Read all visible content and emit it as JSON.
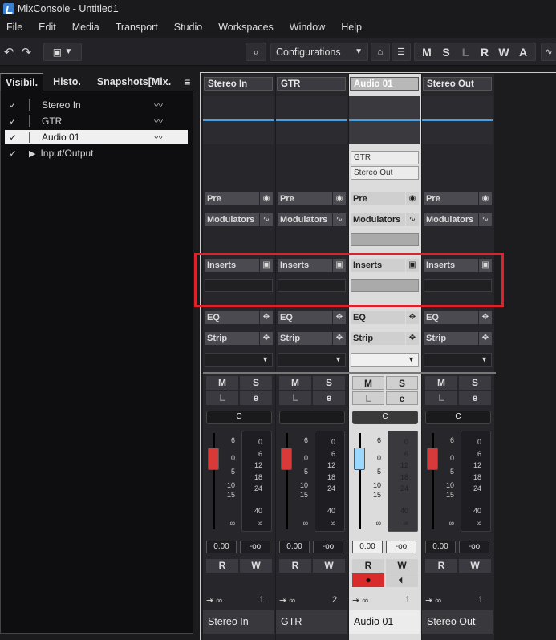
{
  "window": {
    "title": "MixConsole - Untitled1"
  },
  "menu": [
    "File",
    "Edit",
    "Media",
    "Transport",
    "Studio",
    "Workspaces",
    "Window",
    "Help"
  ],
  "toolbar": {
    "configurations_label": "Configurations",
    "msl": [
      "M",
      "S",
      "L",
      "R",
      "W",
      "A"
    ]
  },
  "left_panel": {
    "tabs": [
      "Visibil.",
      "Histo.",
      "Snapshots[Mix."
    ],
    "menu_icon": "≡",
    "items": [
      {
        "check": "✓",
        "label": "Stereo In",
        "wave": "▸▾▸▾"
      },
      {
        "check": "✓",
        "label": "GTR",
        "wave": "▸▾▸▾"
      },
      {
        "check": "✓",
        "label": "Audio 01",
        "wave": "▸▾▸▾"
      },
      {
        "check": "✓",
        "label": "Input/Output",
        "wave": ""
      }
    ]
  },
  "channels": [
    {
      "name": "Stereo In",
      "routing": [],
      "pan": "C",
      "volume": "0.00",
      "peak": "-oo",
      "ms": [
        "M",
        "S"
      ],
      "footer_num": "1"
    },
    {
      "name": "GTR",
      "routing": [],
      "pan": "",
      "volume": "0.00",
      "peak": "-oo",
      "ms": [
        "M",
        "S"
      ],
      "footer_num": "2"
    },
    {
      "name": "Audio 01",
      "routing": [
        "GTR",
        "Stereo Out"
      ],
      "pan": "C",
      "volume": "0.00",
      "peak": "-oo",
      "ms": [
        "M",
        "S"
      ],
      "footer_num": "1"
    },
    {
      "name": "Stereo Out",
      "routing": [],
      "pan": "C",
      "volume": "0.00",
      "peak": "-oo",
      "ms": [
        "M",
        "S"
      ],
      "footer_num": "1"
    }
  ],
  "sections": {
    "pre": "Pre",
    "modulators": "Modulators",
    "inserts": "Inserts",
    "eq": "EQ",
    "strip": "Strip"
  },
  "buttons": {
    "read": "R",
    "write": "W",
    "listen": "L",
    "edit": "e"
  },
  "fader_scale": [
    "6",
    "0",
    "5",
    "10",
    "15",
    "∞"
  ],
  "meter_scale": [
    "0",
    "6",
    "12",
    "18",
    "24",
    "40",
    "∞"
  ],
  "colors": {
    "accent_red": "#e0202a",
    "fader_red": "#d83a3a",
    "fader_blue": "#9ad8ff",
    "record": "#d92b2b"
  }
}
